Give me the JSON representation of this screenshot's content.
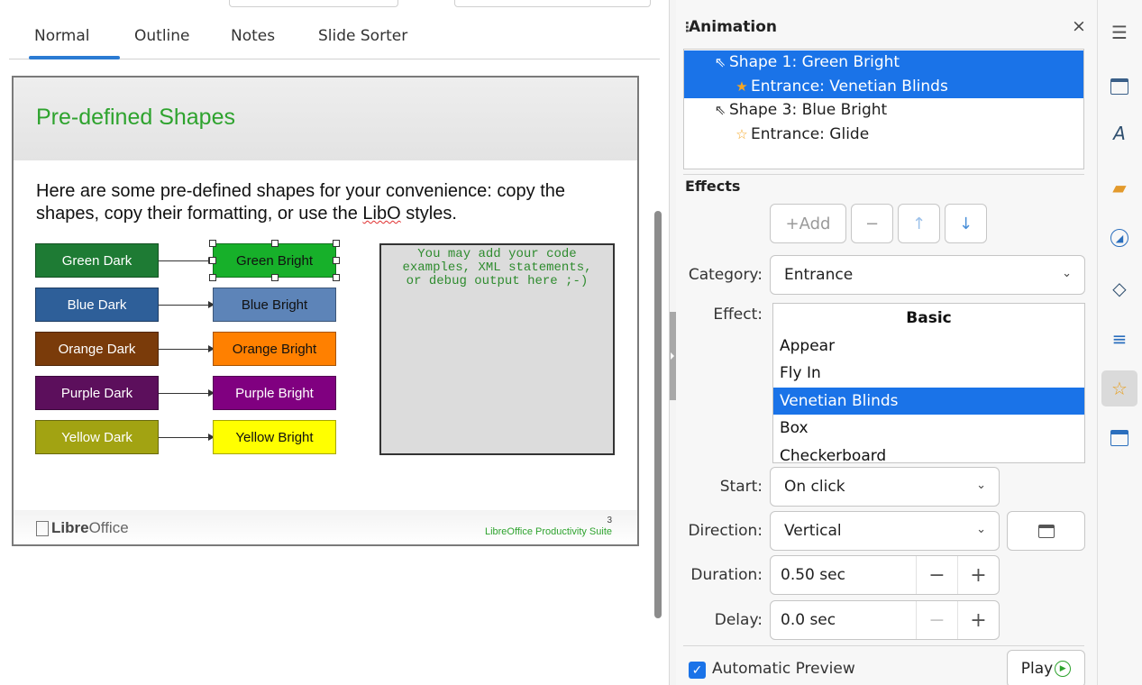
{
  "view_tabs": [
    "Normal",
    "Outline",
    "Notes",
    "Slide Sorter"
  ],
  "slide": {
    "title": "Pre-defined Shapes",
    "body_before": "Here are some pre-defined shapes for your convenience: copy the shapes, copy their formatting, or use the ",
    "body_misspelled": "LibO",
    "body_after": " styles.",
    "shapes_left": [
      "Green Dark",
      "Blue Dark",
      "Orange Dark",
      "Purple Dark",
      "Yellow Dark"
    ],
    "shapes_right": [
      "Green Bright",
      "Blue Bright",
      "Orange Bright",
      "Purple Bright",
      "Yellow Bright"
    ],
    "code_text_1": "You may add your code",
    "code_text_2": "examples, XML statements,",
    "code_text_3": "or debug output here ;-)",
    "logo_bold": "Libre",
    "logo_rest": "Office",
    "footer": "LibreOffice Productivity Suite",
    "page": "3",
    "colors": {
      "green_dark": "#1e7b34",
      "green_bright": "#17b02a",
      "blue_dark": "#2e5f99",
      "blue_bright": "#5d84b8",
      "orange_dark": "#7a3b0a",
      "orange_bright": "#ff8000",
      "purple_dark": "#5c0f5c",
      "purple_bright": "#800080",
      "yellow_dark": "#a2a312",
      "yellow_bright": "#ffff00"
    }
  },
  "panel": {
    "title": "Animation",
    "close": "×",
    "animations": [
      {
        "icon": "pointer-icon",
        "label": "Shape 1: Green Bright",
        "selected": true
      },
      {
        "icon": "star-icon",
        "label": "Entrance: Venetian Blinds",
        "selected": true
      },
      {
        "icon": "pointer-icon",
        "label": "Shape 3: Blue Bright",
        "selected": false
      },
      {
        "icon": "star-icon",
        "label": "Entrance: Glide",
        "selected": false
      }
    ],
    "effects_label": "Effects",
    "add_button": "+Add",
    "remove_button": "−",
    "up_button": "↑",
    "down_button": "↓",
    "category_label": "Category:",
    "category_value": "Entrance",
    "effect_label": "Effect:",
    "effect_items": [
      "Basic",
      "Appear",
      "Fly In",
      "Venetian Blinds",
      "Box",
      "Checkerboard"
    ],
    "effect_selected": "Venetian Blinds",
    "start_label": "Start:",
    "start_value": "On click",
    "direction_label": "Direction:",
    "direction_value": "Vertical",
    "duration_label": "Duration:",
    "duration_value": "0.50 sec",
    "delay_label": "Delay:",
    "delay_value": "0.0 sec",
    "auto_preview_label": "Automatic Preview",
    "auto_preview_checked": true,
    "play_label": "Play"
  },
  "sidebar_tabs": [
    "menu-icon",
    "properties-icon",
    "styles-icon",
    "gallery-icon",
    "navigator-icon",
    "shapes-icon",
    "slide-transition-icon",
    "animation-icon",
    "master-slides-icon"
  ]
}
